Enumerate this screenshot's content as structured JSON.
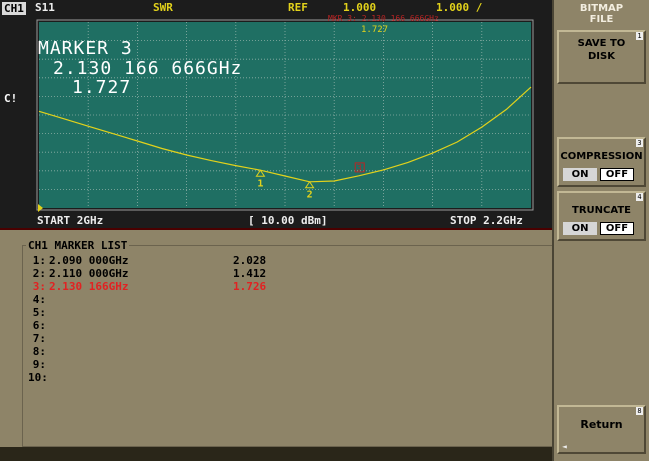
{
  "header": {
    "channel": "CH1",
    "parameter": "S11",
    "format": "SWR",
    "ref_label": "REF",
    "ref_value": "1.000",
    "scale": "1.000 /"
  },
  "display": {
    "marker_title": "MARKER 3",
    "marker_freq": "2.130 166 666GHz",
    "marker_value": "1.727",
    "correction_flag": "C!",
    "ref_tip": "MKR 3: 2.130 166 666GHz",
    "ref_tip_value": "1.727",
    "start": "START 2GHz",
    "power": "[ 10.00 dBm]",
    "stop": "STOP 2.2GHz",
    "trace_color": "#e2d21b",
    "active_marker_color": "#b92525"
  },
  "markers_on_trace": [
    {
      "label": "1",
      "freq_ghz": 2.09,
      "swr": 2.028
    },
    {
      "label": "2",
      "freq_ghz": 2.11,
      "swr": 1.412
    },
    {
      "label": "3",
      "freq_ghz": 2.130166666,
      "swr": 1.726
    }
  ],
  "marker_list": {
    "title": "CH1 MARKER LIST",
    "rows": [
      {
        "num": "1:",
        "freq": "2.090 000GHz",
        "value": "2.028",
        "active": false
      },
      {
        "num": "2:",
        "freq": "2.110 000GHz",
        "value": "1.412",
        "active": false
      },
      {
        "num": "3:",
        "freq": "2.130 166GHz",
        "value": "1.726",
        "active": true
      },
      {
        "num": "4:",
        "freq": "",
        "value": "",
        "active": false
      },
      {
        "num": "5:",
        "freq": "",
        "value": "",
        "active": false
      },
      {
        "num": "6:",
        "freq": "",
        "value": "",
        "active": false
      },
      {
        "num": "7:",
        "freq": "",
        "value": "",
        "active": false
      },
      {
        "num": "8:",
        "freq": "",
        "value": "",
        "active": false
      },
      {
        "num": "9:",
        "freq": "",
        "value": "",
        "active": false
      },
      {
        "num": "10:",
        "freq": "",
        "value": "",
        "active": false
      }
    ]
  },
  "softkeys": {
    "menu_title_line1": "BITMAP",
    "menu_title_line2": "FILE",
    "save_line1": "SAVE TO",
    "save_line2": "DISK",
    "save_num": "1",
    "compression_label": "COMPRESSION",
    "compression_num": "3",
    "compression_on": "ON",
    "compression_off": "OFF",
    "compression_selected": "OFF",
    "truncate_label": "TRUNCATE",
    "truncate_num": "4",
    "truncate_on": "ON",
    "truncate_off": "OFF",
    "truncate_selected": "OFF",
    "return_label": "Return",
    "return_num": "8",
    "return_corner": "◄"
  },
  "chart_data": {
    "type": "line",
    "xlabel": "",
    "ylabel": "",
    "xlim": [
      2.0,
      2.2
    ],
    "ylim": [
      0,
      10
    ],
    "series": [
      {
        "x": [
          2.0,
          2.01,
          2.02,
          2.03,
          2.04,
          2.05,
          2.06,
          2.07,
          2.08,
          2.09,
          2.1,
          2.11,
          2.12,
          2.13,
          2.14,
          2.15,
          2.16,
          2.17,
          2.18,
          2.19,
          2.2
        ],
        "values": [
          5.2,
          4.8,
          4.4,
          4.0,
          3.6,
          3.2,
          2.85,
          2.55,
          2.28,
          2.03,
          1.72,
          1.41,
          1.45,
          1.73,
          2.05,
          2.45,
          2.95,
          3.55,
          4.35,
          5.3,
          6.5
        ]
      }
    ]
  }
}
